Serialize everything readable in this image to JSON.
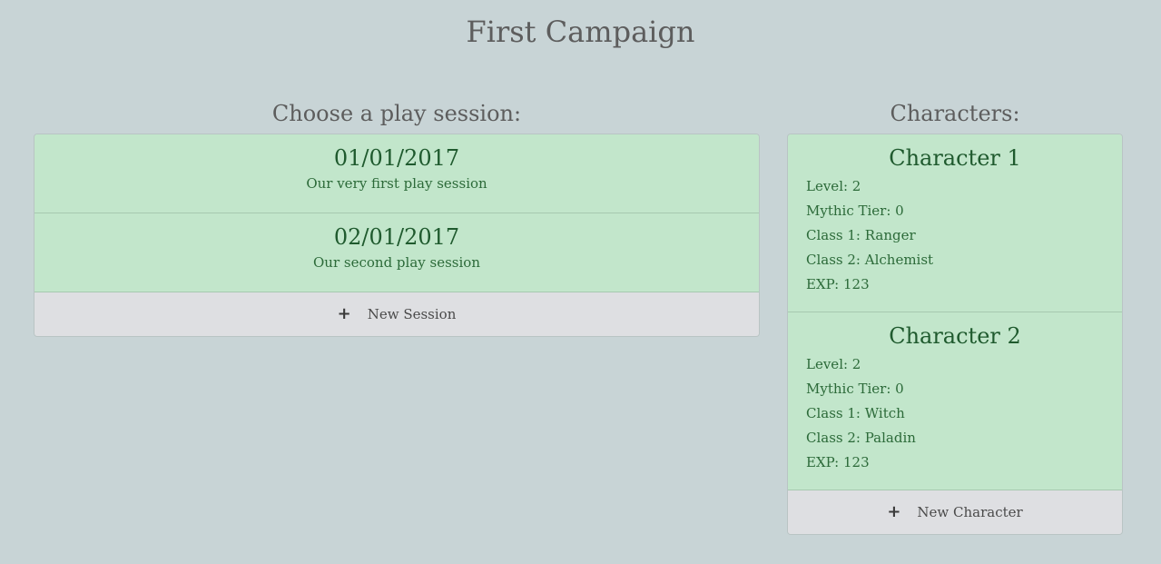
{
  "page": {
    "title": "First Campaign"
  },
  "sessions": {
    "heading": "Choose a play session:",
    "items": [
      {
        "date": "01/01/2017",
        "description": "Our very first play session"
      },
      {
        "date": "02/01/2017",
        "description": "Our second play session"
      }
    ],
    "new_label": "New Session"
  },
  "characters": {
    "heading": "Characters:",
    "items": [
      {
        "name": "Character 1",
        "level": "Level: 2",
        "mythic": "Mythic Tier: 0",
        "class1": "Class 1: Ranger",
        "class2": "Class 2: Alchemist",
        "exp": "EXP: 123"
      },
      {
        "name": "Character 2",
        "level": "Level: 2",
        "mythic": "Mythic Tier: 0",
        "class1": "Class 1: Witch",
        "class2": "Class 2: Paladin",
        "exp": "EXP: 123"
      }
    ],
    "new_label": "New Character"
  },
  "icons": {
    "add": "plus-icon"
  },
  "colors": {
    "background": "#c8d4d6",
    "item_bg": "#c2e6cb",
    "item_text": "#1f5a2e",
    "button_bg": "#dedfe2"
  }
}
